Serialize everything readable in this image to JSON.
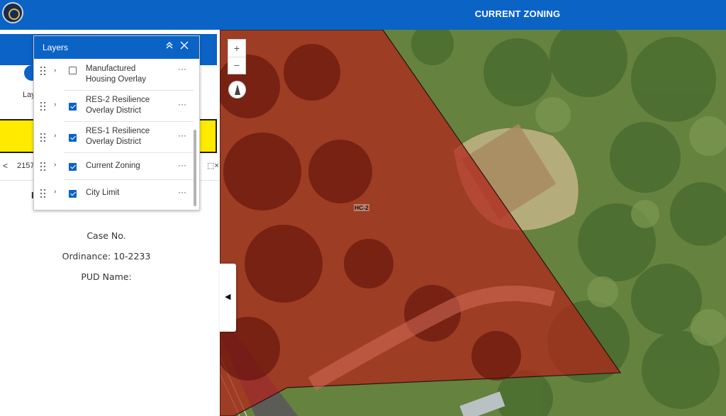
{
  "app": {
    "title": "CURRENT ZONING"
  },
  "sidebar": {
    "widget_label": "Lay",
    "pager": {
      "prev": "<",
      "value": "2157",
      "clear": "⬚×"
    },
    "heading_partial": "I",
    "info": {
      "case_no": "Case No.",
      "ordinance": "Ordinance: 10-2233",
      "pud_name": "PUD Name:"
    },
    "collapse_arrow": "◀"
  },
  "map": {
    "zoom_in": "+",
    "zoom_out": "−",
    "zone_label": "HC-2",
    "colors": {
      "zone_fill": "#b3231a",
      "zone_outline": "#2a1210",
      "vegetation": "#5f7d3a"
    }
  },
  "layers_panel": {
    "title": "Layers",
    "collapse_icon": "chevron-double-up-icon",
    "close_icon": "close-icon",
    "items": [
      {
        "label": "Manufactured Housing Overlay",
        "checked": false
      },
      {
        "label": "RES-2 Resilience Overlay District",
        "checked": true
      },
      {
        "label": "RES-1 Resilience Overlay District",
        "checked": true
      },
      {
        "label": "Current Zoning",
        "checked": true
      },
      {
        "label": "City Limit",
        "checked": true
      }
    ],
    "more_label": "···"
  }
}
